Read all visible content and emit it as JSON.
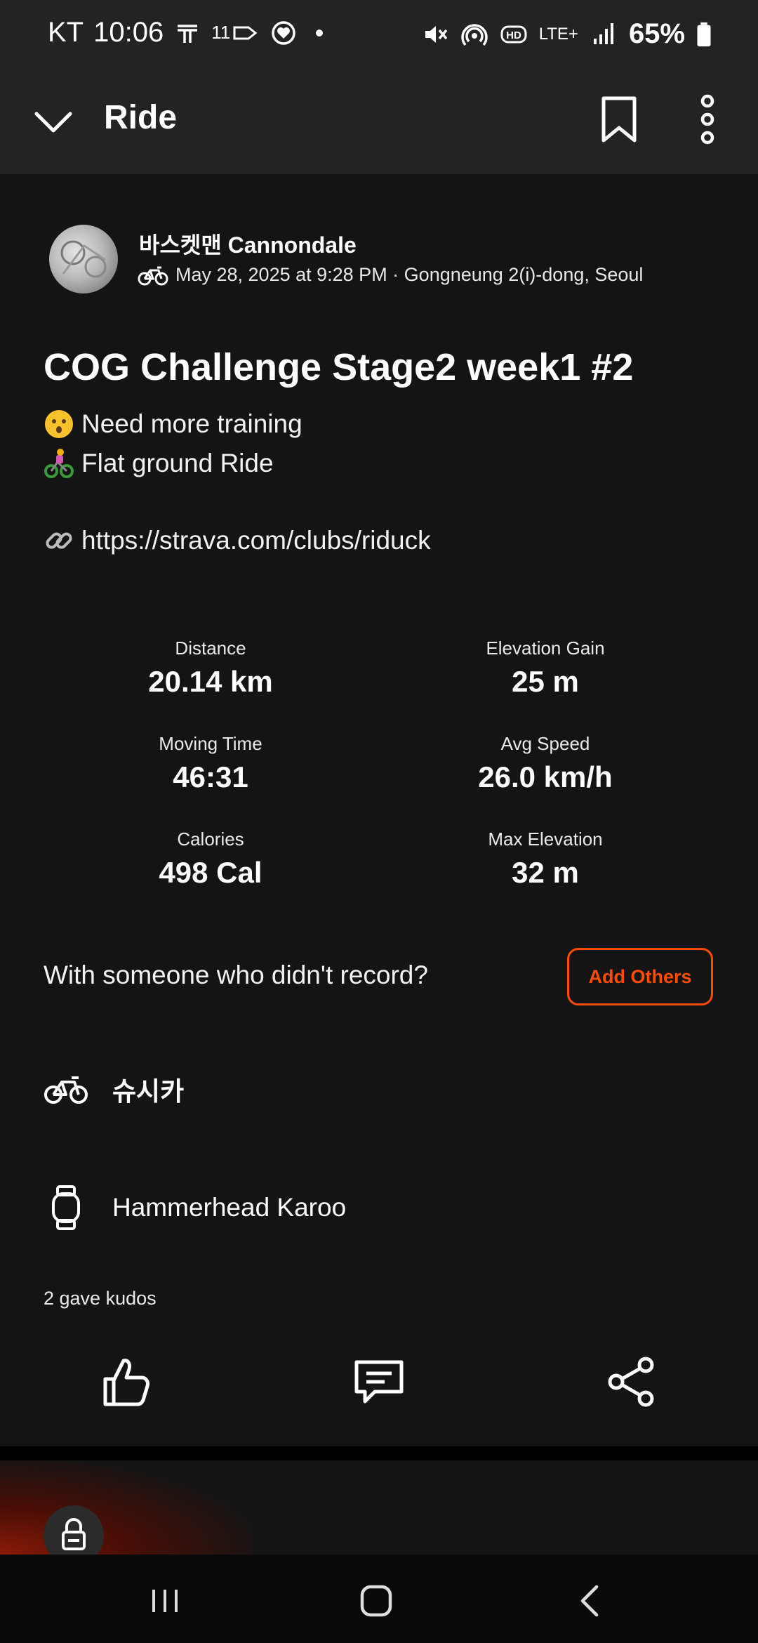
{
  "status_bar": {
    "carrier": "KT",
    "time": "10:06",
    "extra_small": "11",
    "network": "LTE+",
    "battery": "65%"
  },
  "app_bar": {
    "title": "Ride"
  },
  "athlete": {
    "name": "바스켓맨 Cannondale",
    "meta": "May 28, 2025 at 9:28 PM · Gongneung 2(i)-dong, Seoul"
  },
  "activity": {
    "title": "COG Challenge Stage2 week1 #2",
    "description_lines": [
      {
        "emoji": "astonished-face",
        "text": "Need more training"
      },
      {
        "emoji": "person-biking",
        "text": "Flat ground Ride"
      },
      {
        "emoji": "link",
        "text": "https://strava.com/clubs/riduck"
      }
    ]
  },
  "stats": [
    {
      "label": "Distance",
      "value": "20.14 km"
    },
    {
      "label": "Elevation Gain",
      "value": "25 m"
    },
    {
      "label": "Moving Time",
      "value": "46:31"
    },
    {
      "label": "Avg Speed",
      "value": "26.0 km/h"
    },
    {
      "label": "Calories",
      "value": "498 Cal"
    },
    {
      "label": "Max Elevation",
      "value": "32 m"
    }
  ],
  "with_others": {
    "prompt": "With someone who didn't record?",
    "button": "Add Others"
  },
  "gear": {
    "bike": {
      "icon": "bike-icon",
      "name": "슈시카"
    },
    "device": {
      "icon": "watch-icon",
      "name": "Hammerhead Karoo"
    }
  },
  "kudos_text": "2 gave kudos",
  "colors": {
    "accent": "#fc4c02",
    "background": "#141414",
    "bar": "#232323"
  }
}
